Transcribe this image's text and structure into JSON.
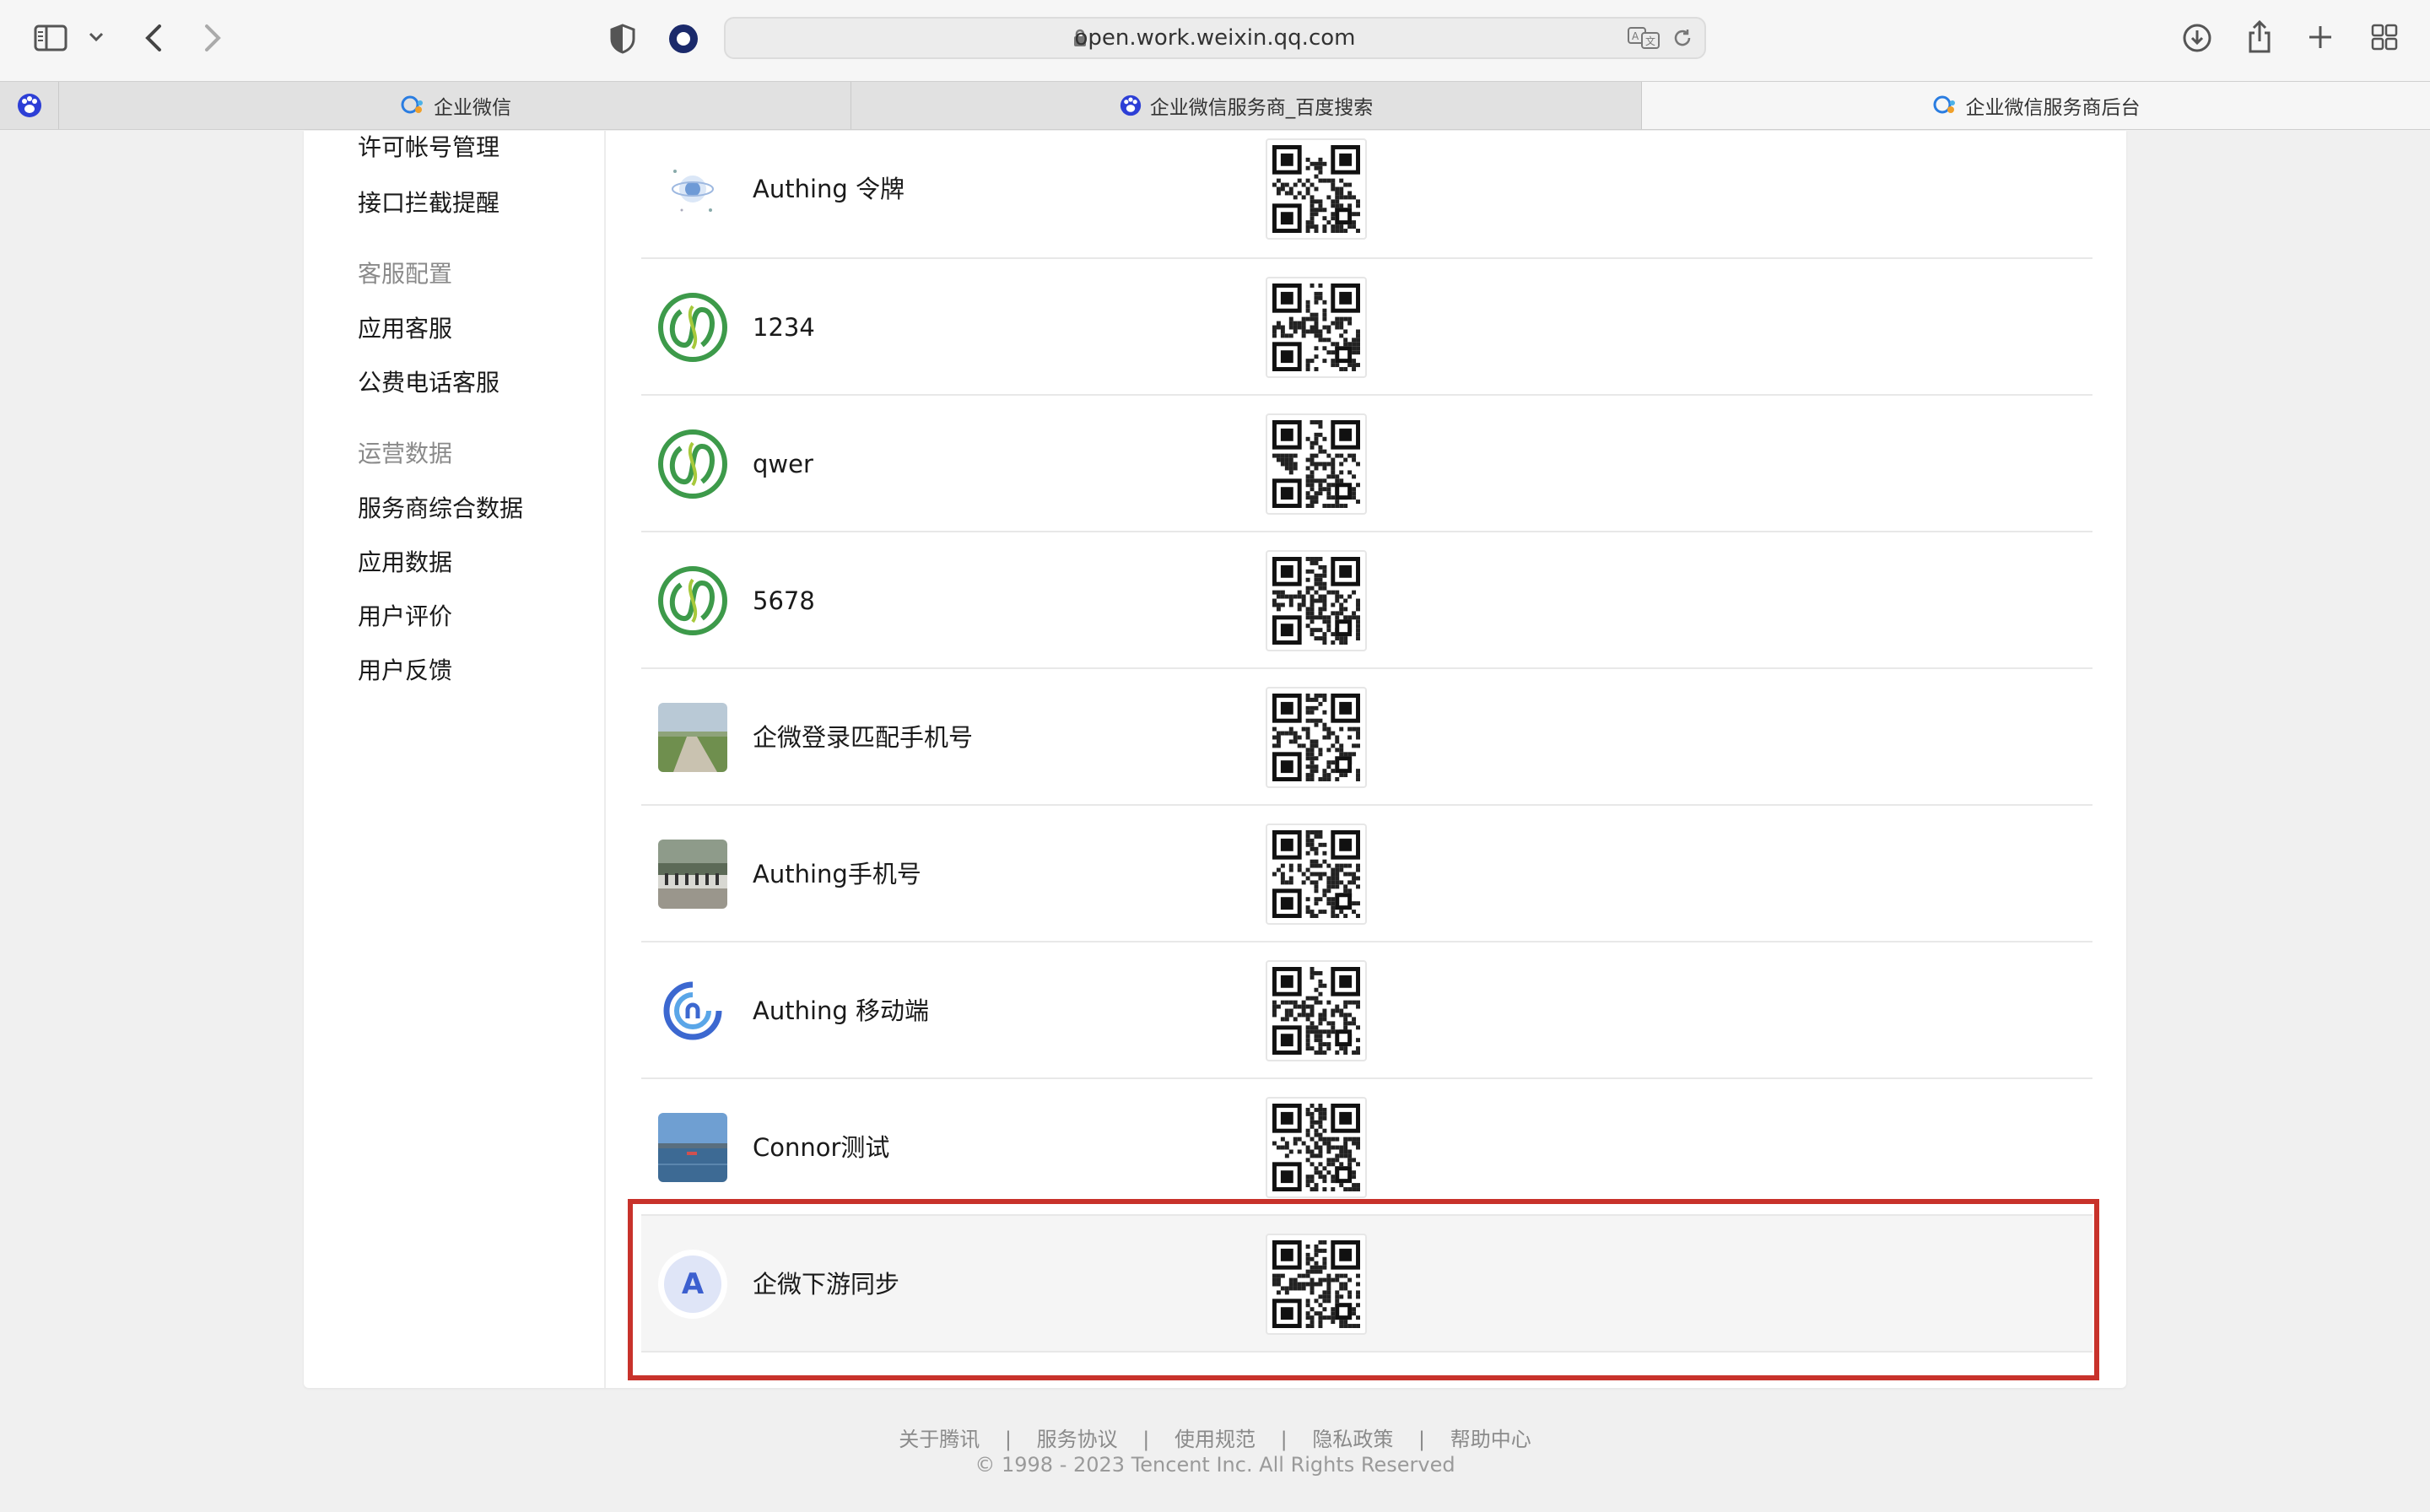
{
  "browser": {
    "url": "open.work.weixin.qq.com"
  },
  "tabs": [
    {
      "label": "企业微信",
      "active": false
    },
    {
      "label": "企业微信服务商_百度搜索",
      "active": false
    },
    {
      "label": "企业微信服务商后台",
      "active": true
    }
  ],
  "sidebar": {
    "items_top": [
      "许可帐号管理",
      "接口拦截提醒"
    ],
    "group_service": "客服配置",
    "service_items": [
      "应用客服",
      "公费电话客服"
    ],
    "group_ops": "运营数据",
    "ops_items": [
      "服务商综合数据",
      "应用数据",
      "用户评价",
      "用户反馈"
    ]
  },
  "apps": [
    {
      "name": "Authing 令牌",
      "icon": "authing-token-logo-icon"
    },
    {
      "name": "1234",
      "icon": "green-knot-logo-icon"
    },
    {
      "name": "qwer",
      "icon": "green-knot-logo-icon"
    },
    {
      "name": "5678",
      "icon": "green-knot-logo-icon"
    },
    {
      "name": "企微登录匹配手机号",
      "icon": "road-photo-icon"
    },
    {
      "name": "Authing手机号",
      "icon": "seashore-photo-icon"
    },
    {
      "name": "Authing 移动端",
      "icon": "authing-ring-logo-icon"
    },
    {
      "name": "Connor测试",
      "icon": "lake-photo-icon"
    },
    {
      "name": "企微下游同步",
      "icon": "letter-avatar-icon",
      "avatar_letter": "A",
      "highlighted": true
    }
  ],
  "footer": {
    "links": [
      "关于腾讯",
      "服务协议",
      "使用规范",
      "隐私政策",
      "帮助中心"
    ],
    "separator": "|",
    "copyright": "© 1998 - 2023 Tencent Inc. All Rights Reserved"
  },
  "colors": {
    "highlight_border": "#c8322b",
    "knot_green": "#3d9a4a",
    "avatar_bg": "#dfe5f7",
    "avatar_fg": "#3c5fcf"
  }
}
